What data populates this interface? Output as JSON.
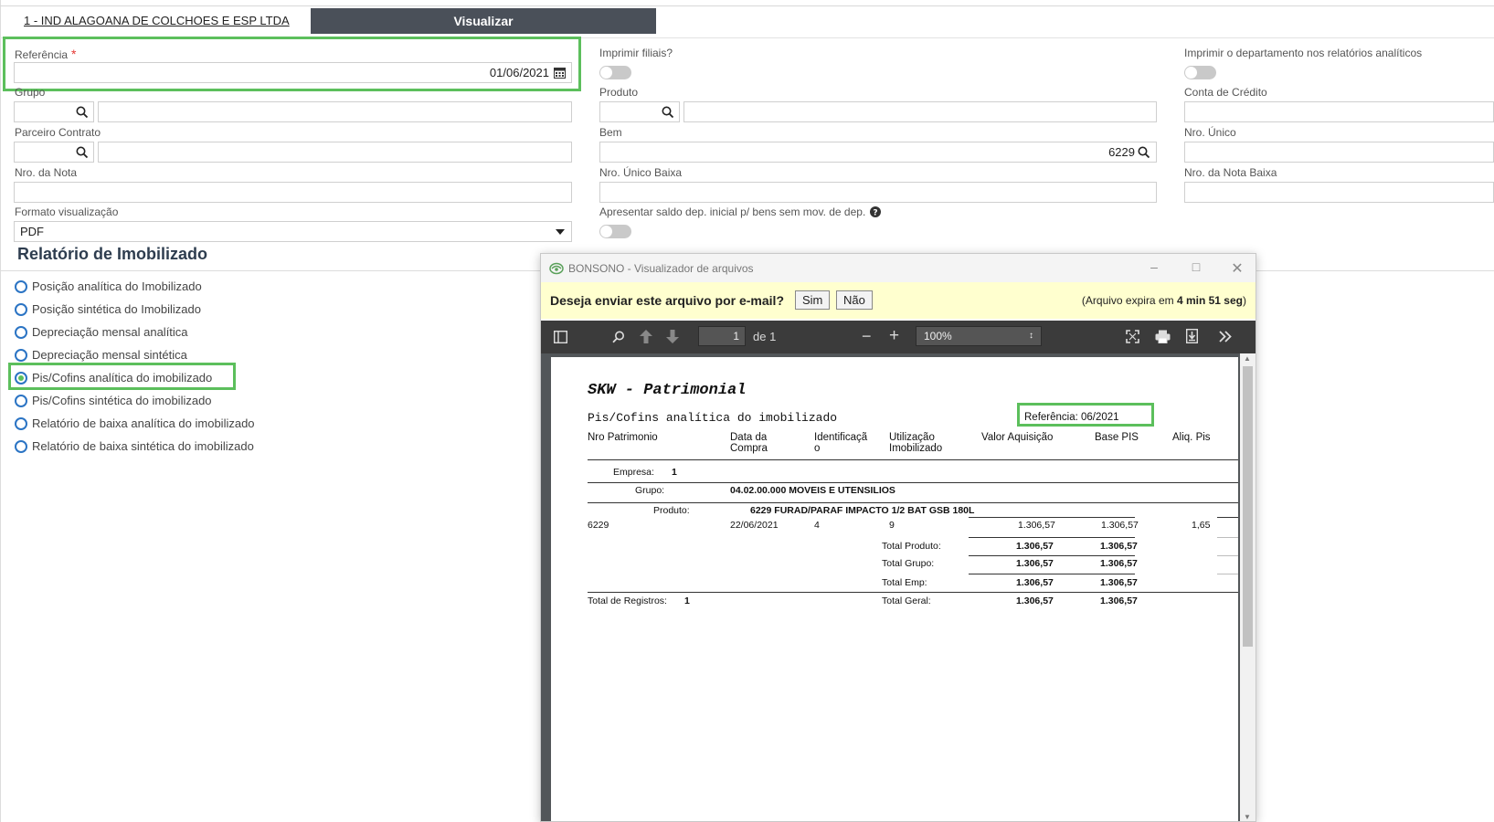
{
  "header": {
    "company": "1 - IND ALAGOANA DE COLCHOES E ESP LTDA",
    "visualizar_label": "Visualizar"
  },
  "form": {
    "referencia_label": "Referência",
    "referencia_required": "*",
    "referencia_value": "01/06/2021",
    "imprimir_filiais_label": "Imprimir filiais?",
    "imprimir_depto_label": "Imprimir o departamento nos relatórios analíticos",
    "grupo_label": "Grupo",
    "produto_label": "Produto",
    "conta_credito_label": "Conta de Crédito",
    "parceiro_label": "Parceiro Contrato",
    "bem_label": "Bem",
    "bem_value": "6229",
    "nro_unico_label": "Nro. Único",
    "nro_nota_label": "Nro. da Nota",
    "nro_unico_baixa_label": "Nro. Único Baixa",
    "nro_nota_baixa_label": "Nro. da Nota Baixa",
    "formato_label": "Formato visualização",
    "formato_value": "PDF",
    "saldo_label": "Apresentar saldo dep. inicial p/ bens sem mov. de dep."
  },
  "report_section": {
    "title": "Relatório de Imobilizado",
    "options": [
      "Posição analítica do Imobilizado",
      "Posição sintética do Imobilizado",
      "Depreciação mensal analítica",
      "Depreciação mensal sintética",
      "Pis/Cofins analítica do imobilizado",
      "Pis/Cofins sintética do imobilizado",
      "Relatório de baixa analítica do imobilizado",
      "Relatório de baixa sintética do imobilizado"
    ],
    "selected_index": 4
  },
  "viewer": {
    "title": "BONSONO - Visualizador de arquivos",
    "mail_question": "Deseja enviar este arquivo por e-mail?",
    "sim_label": "Sim",
    "nao_label": "Não",
    "expira_prefix": "(Arquivo expira em ",
    "expira_time": "4 min 51 seg",
    "expira_suffix": ")",
    "page_current": "1",
    "page_of": "de 1",
    "zoom": "100%"
  },
  "pdf": {
    "title": "SKW - Patrimonial",
    "subtitle": "Pis/Cofins analítica do imobilizado",
    "referencia": "Referência: 06/2021",
    "col_nro": "Nro Patrimonio",
    "col_data_1": "Data da",
    "col_data_2": "Compra",
    "col_ident_1": "Identificaçã",
    "col_ident_2": "o",
    "col_util_1": "Utilização",
    "col_util_2": "Imobilizado",
    "col_valor": "Valor Aquisição",
    "col_base": "Base PIS",
    "col_aliq": "Aliq. Pis",
    "empresa_label": "Empresa:",
    "empresa_value": "1",
    "grupo_label": "Grupo:",
    "grupo_value": "04.02.00.000 MOVEIS E UTENSILIOS",
    "produto_label": "Produto:",
    "produto_value": "6229 FURAD/PARAF IMPACTO 1/2 BAT GSB 180L",
    "row_nro": "6229",
    "row_data": "22/06/2021",
    "row_ident": "4",
    "row_util": "9",
    "row_valor": "1.306,57",
    "row_base": "1.306,57",
    "row_aliq": "1,65",
    "total_produto_label": "Total Produto:",
    "total_produto_valor": "1.306,57",
    "total_produto_base": "1.306,57",
    "total_grupo_label": "Total Grupo:",
    "total_grupo_valor": "1.306,57",
    "total_grupo_base": "1.306,57",
    "total_emp_label": "Total Emp:",
    "total_emp_valor": "1.306,57",
    "total_emp_base": "1.306,57",
    "total_registros_label": "Total de Registros:",
    "total_registros_value": "1",
    "total_geral_label": "Total Geral:",
    "total_geral_valor": "1.306,57",
    "total_geral_base": "1.306,57"
  }
}
